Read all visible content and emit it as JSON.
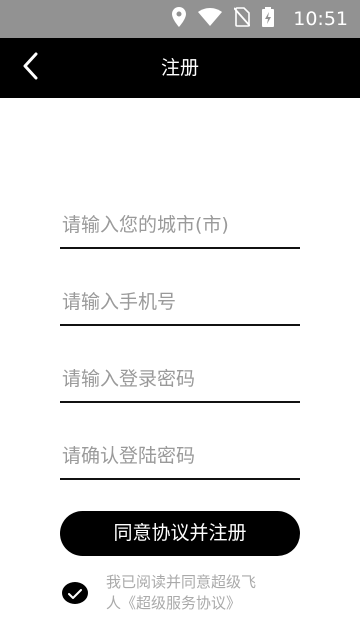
{
  "status_bar": {
    "time": "10:51",
    "icons": [
      "location-icon",
      "wifi-icon",
      "no-sim-icon",
      "battery-charging-icon"
    ]
  },
  "header": {
    "title": "注册",
    "back_icon": "chevron-left-icon"
  },
  "form": {
    "city_placeholder": "请输入您的城市(市)",
    "phone_placeholder": "请输入手机号",
    "password_placeholder": "请输入登录密码",
    "confirm_password_placeholder": "请确认登陆密码"
  },
  "submit_label": "同意协议并注册",
  "agreement": {
    "checked": true,
    "line1": "我已阅读并同意超级飞",
    "line2": "人《超级服务协议》"
  },
  "colors": {
    "status_bar": "#929292",
    "title_bar": "#000000",
    "placeholder": "#9a9a9a",
    "agreement_text": "#aaaaaa"
  }
}
